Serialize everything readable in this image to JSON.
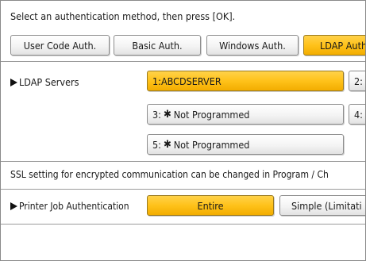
{
  "instruction": "Select an authentication method, then press [OK].",
  "auth_tabs": [
    {
      "label": "User Code Auth.",
      "selected": false
    },
    {
      "label": "Basic Auth.",
      "selected": false
    },
    {
      "label": "Windows Auth.",
      "selected": false
    },
    {
      "label": "LDAP Auth",
      "selected": true
    }
  ],
  "ldap_servers": {
    "label": "LDAP Servers",
    "slots": [
      {
        "num": "1",
        "name": "ABCDSERVER",
        "programmed": true,
        "selected": true
      },
      {
        "num": "2",
        "name": "",
        "programmed": false,
        "selected": false
      },
      {
        "num": "3",
        "name": "Not Programmed",
        "programmed": false,
        "selected": false
      },
      {
        "num": "4",
        "name": "",
        "programmed": false,
        "selected": false
      },
      {
        "num": "5",
        "name": "Not Programmed",
        "programmed": false,
        "selected": false
      }
    ],
    "star_symbol": "✱"
  },
  "ssl_note": "SSL setting for encrypted communication can be changed in Program / Ch",
  "printer_job_auth": {
    "label": "Printer Job Authentication",
    "options": [
      {
        "label": "Entire",
        "selected": true
      },
      {
        "label": "Simple (Limitati",
        "selected": false
      }
    ]
  },
  "colors": {
    "selected": "#ffc21a",
    "border": "#8e8e8e",
    "background": "#ffffff"
  }
}
